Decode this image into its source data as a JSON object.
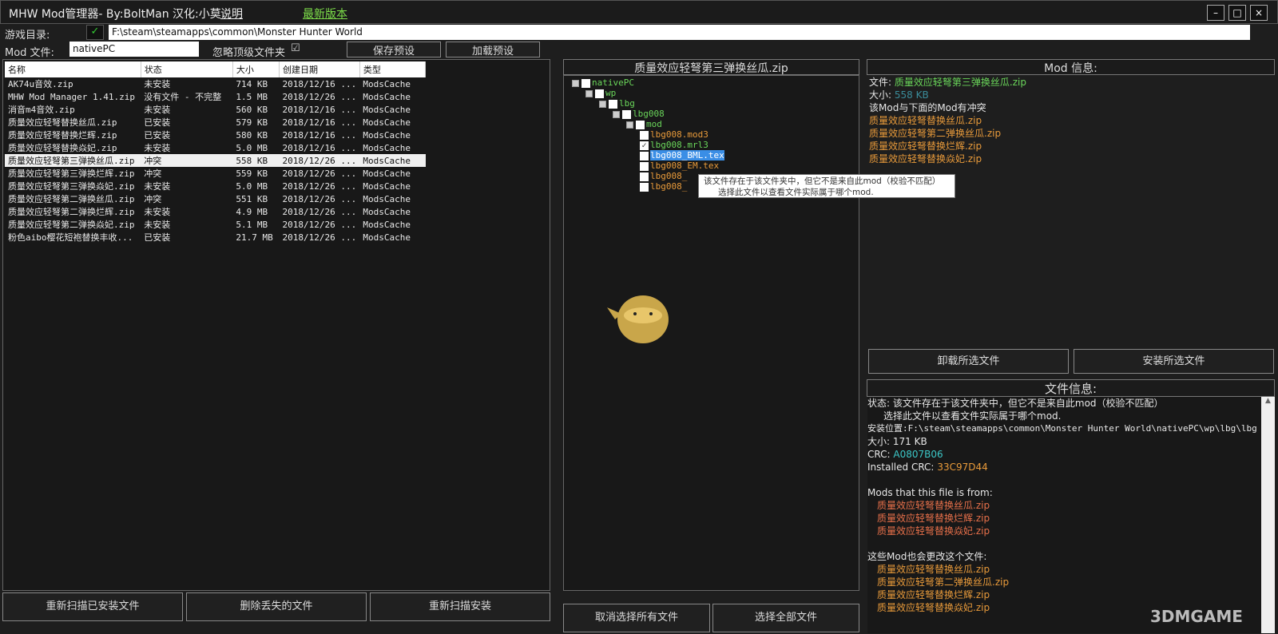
{
  "window": {
    "title": "MHW Mod管理器- By:BoltMan 汉化:小莫",
    "help_link": "说明",
    "latest_link": "最新版本",
    "minimize": "–",
    "maximize": "□",
    "close": "×"
  },
  "settings": {
    "game_dir_label": "游戏目录:",
    "game_dir_valid": "✓",
    "game_dir": "F:\\steam\\steamapps\\common\\Monster Hunter World",
    "mod_file_label": "Mod 文件:",
    "mod_file": "nativePC",
    "ignore_top_label": "忽略顶级文件夹",
    "ignore_top_checked": "☑",
    "save_preset": "保存预设",
    "load_preset": "加载预设"
  },
  "mod_list": {
    "columns": [
      "名称",
      "状态",
      "大小",
      "创建日期",
      "类型"
    ],
    "rows": [
      [
        "AK74u音效.zip",
        "未安装",
        "714 KB",
        "2018/12/16 ...",
        "ModsCache"
      ],
      [
        "MHW Mod Manager 1.41.zip",
        "没有文件 - 不完整",
        "1.5 MB",
        "2018/12/26 ...",
        "ModsCache"
      ],
      [
        "消音m4音效.zip",
        "未安装",
        "560 KB",
        "2018/12/16 ...",
        "ModsCache"
      ],
      [
        "质量效应轻弩替换丝瓜.zip",
        "已安装",
        "579 KB",
        "2018/12/16 ...",
        "ModsCache"
      ],
      [
        "质量效应轻弩替换烂辉.zip",
        "已安装",
        "580 KB",
        "2018/12/16 ...",
        "ModsCache"
      ],
      [
        "质量效应轻弩替换焱妃.zip",
        "未安装",
        "5.0 MB",
        "2018/12/16 ...",
        "ModsCache"
      ],
      [
        "质量效应轻弩第三弹换丝瓜.zip",
        "冲突",
        "558 KB",
        "2018/12/26 ...",
        "ModsCache"
      ],
      [
        "质量效应轻弩第三弹换烂辉.zip",
        "冲突",
        "559 KB",
        "2018/12/26 ...",
        "ModsCache"
      ],
      [
        "质量效应轻弩第三弹换焱妃.zip",
        "未安装",
        "5.0 MB",
        "2018/12/26 ...",
        "ModsCache"
      ],
      [
        "质量效应轻弩第二弹换丝瓜.zip",
        "冲突",
        "551 KB",
        "2018/12/26 ...",
        "ModsCache"
      ],
      [
        "质量效应轻弩第二弹换烂辉.zip",
        "未安装",
        "4.9 MB",
        "2018/12/26 ...",
        "ModsCache"
      ],
      [
        "质量效应轻弩第二弹换焱妃.zip",
        "未安装",
        "5.1 MB",
        "2018/12/26 ...",
        "ModsCache"
      ],
      [
        "粉色aibo樱花短袍替换丰收...",
        "已安装",
        "21.7 MB",
        "2018/12/26 ...",
        "ModsCache"
      ]
    ],
    "selected_index": 6,
    "buttons": [
      "重新扫描已安装文件",
      "删除丢失的文件",
      "重新扫描安装"
    ]
  },
  "file_tree": {
    "title": "质量效应轻弩第三弹换丝瓜.zip",
    "nodes": [
      {
        "label": "nativePC",
        "depth": 0,
        "folder": true,
        "checked": false,
        "color": "green"
      },
      {
        "label": "wp",
        "depth": 1,
        "folder": true,
        "checked": false,
        "color": "green"
      },
      {
        "label": "lbg",
        "depth": 2,
        "folder": true,
        "checked": false,
        "color": "green"
      },
      {
        "label": "lbg008",
        "depth": 3,
        "folder": true,
        "checked": false,
        "color": "green"
      },
      {
        "label": "mod",
        "depth": 4,
        "folder": true,
        "checked": false,
        "color": "green"
      },
      {
        "label": "lbg008.mod3",
        "depth": 5,
        "folder": false,
        "checked": false,
        "color": "orange"
      },
      {
        "label": "lbg008.mrl3",
        "depth": 5,
        "folder": false,
        "checked": true,
        "color": "green"
      },
      {
        "label": "lbg008_BML.tex",
        "depth": 5,
        "folder": false,
        "checked": false,
        "color": "selected"
      },
      {
        "label": "lbg008_EM.tex",
        "depth": 5,
        "folder": false,
        "checked": false,
        "color": "orange"
      },
      {
        "label": "lbg008_",
        "depth": 5,
        "folder": false,
        "checked": false,
        "color": "orange"
      },
      {
        "label": "lbg008_",
        "depth": 5,
        "folder": false,
        "checked": false,
        "color": "orange"
      }
    ],
    "tooltip": [
      "该文件存在于该文件夹中，但它不是来自此mod（校验不匹配）",
      "选择此文件以查看文件实际属于哪个mod."
    ],
    "buttons": [
      "取消选择所有文件",
      "选择全部文件"
    ]
  },
  "mod_info": {
    "title": "Mod 信息:",
    "file_label": "文件:",
    "file": "质量效应轻弩第三弹换丝瓜.zip",
    "size_label": "大小:",
    "size": "558 KB",
    "conflict_text": "该Mod与下面的Mod有冲突",
    "conflicts": [
      "质量效应轻弩替换丝瓜.zip",
      "质量效应轻弩第二弹换丝瓜.zip",
      "质量效应轻弩替换烂辉.zip",
      "质量效应轻弩替换焱妃.zip"
    ],
    "buttons": [
      "卸载所选文件",
      "安装所选文件"
    ]
  },
  "file_info": {
    "title": "文件信息:",
    "status_label": "状态:",
    "status": "该文件存在于该文件夹中，但它不是来自此mod（校验不匹配）",
    "status2": "选择此文件以查看文件实际属于哪个mod.",
    "location_label": "安装位置:",
    "location": "F:\\steam\\steamapps\\common\\Monster Hunter World\\nativePC\\wp\\lbg\\lbg",
    "size_label": "大小:",
    "size": "171 KB",
    "crc_label": "CRC:",
    "crc": "A0807B06",
    "installed_crc_label": "Installed CRC:",
    "installed_crc": "33C97D44",
    "from_label": "Mods that this file is from:",
    "from_mods": [
      "质量效应轻弩替换丝瓜.zip",
      "质量效应轻弩替换烂辉.zip",
      "质量效应轻弩替换焱妃.zip"
    ],
    "also_label": "这些Mod也会更改这个文件:",
    "also_mods": [
      "质量效应轻弩替换丝瓜.zip",
      "质量效应轻弩第二弹换丝瓜.zip",
      "质量效应轻弩替换烂辉.zip",
      "质量效应轻弩替换焱妃.zip"
    ]
  },
  "watermark": "3DMGAME"
}
